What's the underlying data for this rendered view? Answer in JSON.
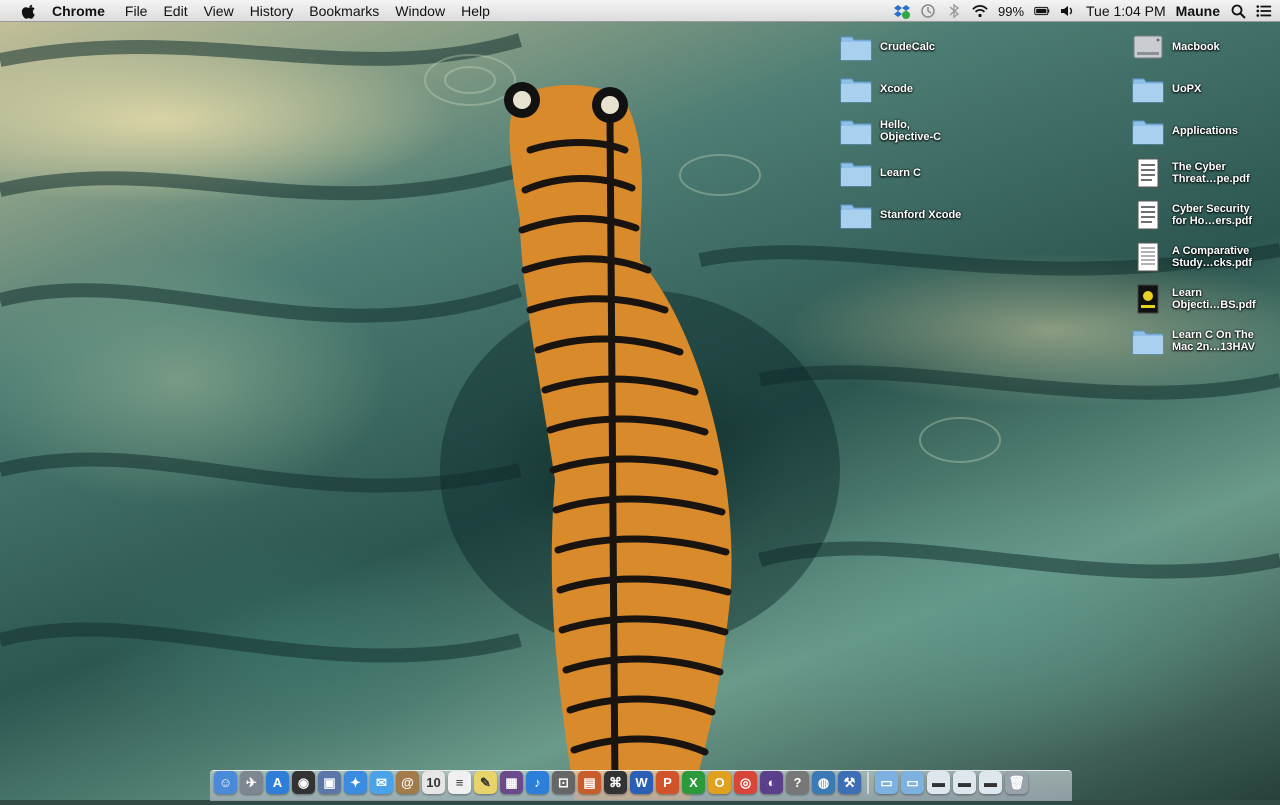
{
  "menubar": {
    "app": "Chrome",
    "menus": [
      "File",
      "Edit",
      "View",
      "History",
      "Bookmarks",
      "Window",
      "Help"
    ],
    "battery": "99%",
    "clock": "Tue 1:04 PM",
    "user": "Maune"
  },
  "desktop": {
    "column1": [
      {
        "label": "CrudeCalc",
        "icon": "folder-icon"
      },
      {
        "label": "Xcode",
        "icon": "folder-icon"
      },
      {
        "label": "Hello,\nObjective-C",
        "icon": "folder-icon"
      },
      {
        "label": "Learn C",
        "icon": "folder-icon"
      },
      {
        "label": "Stanford Xcode",
        "icon": "folder-icon"
      }
    ],
    "column2": [
      {
        "label": "Macbook",
        "icon": "hard-drive-icon"
      },
      {
        "label": "UoPX",
        "icon": "folder-icon"
      },
      {
        "label": "Applications",
        "icon": "folder-icon"
      },
      {
        "label": "The Cyber\nThreat…pe.pdf",
        "icon": "pdf-icon"
      },
      {
        "label": "Cyber Security\nfor Ho…ers.pdf",
        "icon": "pdf-icon"
      },
      {
        "label": "A Comparative\nStudy…cks.pdf",
        "icon": "pdf-icon"
      },
      {
        "label": "Learn\nObjecti…BS.pdf",
        "icon": "book-pdf-icon"
      },
      {
        "label": "Learn C On The\nMac 2n…13HAV",
        "icon": "folder-icon"
      }
    ]
  },
  "dock": {
    "apps": [
      {
        "name": "finder",
        "color": "#4a8ad8",
        "glyph": "☺"
      },
      {
        "name": "launchpad",
        "color": "#7d8791",
        "glyph": "✈"
      },
      {
        "name": "app-store",
        "color": "#2f7fd8",
        "glyph": "A"
      },
      {
        "name": "dashboard",
        "color": "#333333",
        "glyph": "◉"
      },
      {
        "name": "preview",
        "color": "#5a77a8",
        "glyph": "▣"
      },
      {
        "name": "safari",
        "color": "#3b8be0",
        "glyph": "✦"
      },
      {
        "name": "messages",
        "color": "#4aa3e8",
        "glyph": "✉"
      },
      {
        "name": "contacts",
        "color": "#a37a4a",
        "glyph": "@"
      },
      {
        "name": "calendar",
        "color": "#e6e6e6",
        "glyph": "10"
      },
      {
        "name": "reminders",
        "color": "#f0f0f0",
        "glyph": "≡"
      },
      {
        "name": "notes",
        "color": "#e8d36a",
        "glyph": "✎"
      },
      {
        "name": "photo-booth",
        "color": "#6a4a8a",
        "glyph": "▦"
      },
      {
        "name": "itunes",
        "color": "#2b7fd8",
        "glyph": "♪"
      },
      {
        "name": "screenshot",
        "color": "#666666",
        "glyph": "⊡"
      },
      {
        "name": "keynote",
        "color": "#c75d2c",
        "glyph": "▤"
      },
      {
        "name": "terminal",
        "color": "#333333",
        "glyph": "⌘"
      },
      {
        "name": "microsoft-word",
        "color": "#2b5fb5",
        "glyph": "W"
      },
      {
        "name": "microsoft-powerpoint",
        "color": "#d1532a",
        "glyph": "P"
      },
      {
        "name": "microsoft-excel",
        "color": "#2b9a3a",
        "glyph": "X"
      },
      {
        "name": "microsoft-outlook",
        "color": "#e0a020",
        "glyph": "O"
      },
      {
        "name": "google-chrome",
        "color": "#d8463a",
        "glyph": "◎"
      },
      {
        "name": "eclipse",
        "color": "#5a3f8a",
        "glyph": "◐"
      },
      {
        "name": "help",
        "color": "#777777",
        "glyph": "?"
      },
      {
        "name": "network",
        "color": "#3a7ab5",
        "glyph": "◍"
      },
      {
        "name": "xcode",
        "color": "#3c6fb5",
        "glyph": "⚒"
      }
    ],
    "stacks": [
      {
        "name": "applications-folder",
        "color": "#7db2e0",
        "glyph": "▭"
      },
      {
        "name": "documents-folder",
        "color": "#7db2e0",
        "glyph": "▭"
      },
      {
        "name": "downloads-stack",
        "color": "#dfe7ee",
        "glyph": "▬"
      },
      {
        "name": "desktop-stack",
        "color": "#dfe7ee",
        "glyph": "▬"
      },
      {
        "name": "recent-stack",
        "color": "#dfe7ee",
        "glyph": "▬"
      },
      {
        "name": "trash",
        "color": "#9aa3ab",
        "glyph": "🗑"
      }
    ]
  }
}
